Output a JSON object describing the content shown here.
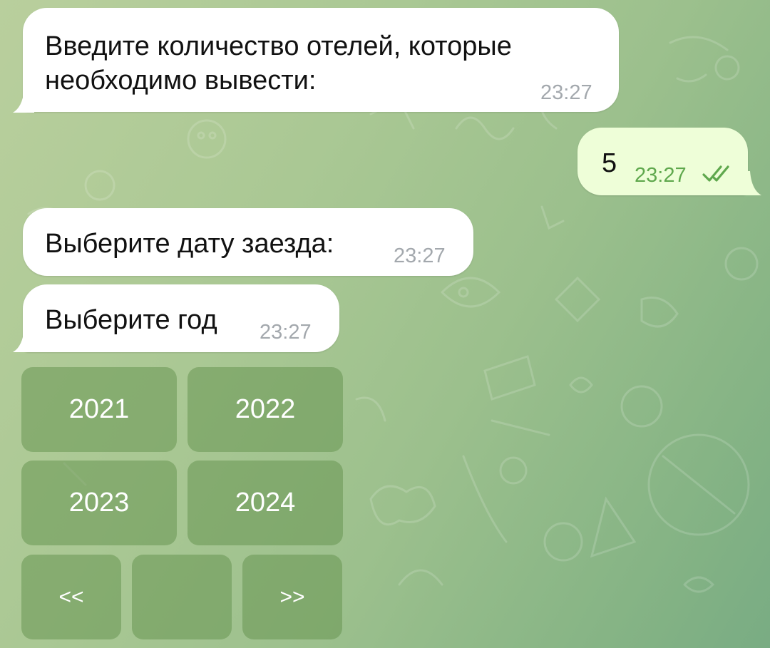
{
  "chat": {
    "messages": [
      {
        "direction": "incoming",
        "text": "Введите количество отелей, которые\nнеобходимо вывести:",
        "time": "23:27"
      },
      {
        "direction": "outgoing",
        "text": "5",
        "time": "23:27",
        "status": "read"
      },
      {
        "direction": "incoming",
        "text": "Выберите дату заезда:",
        "time": "23:27"
      },
      {
        "direction": "incoming",
        "text": "Выберите год",
        "time": "23:27"
      }
    ],
    "keyboard": {
      "rows": [
        [
          "2021",
          "2022"
        ],
        [
          "2023",
          "2024"
        ],
        [
          "<<",
          "",
          ">>"
        ]
      ]
    }
  },
  "colors": {
    "incoming_bubble": "#ffffff",
    "outgoing_bubble": "#eefed8",
    "time_incoming": "#a3a8ad",
    "time_outgoing": "#5fa84d",
    "keyboard_button": "#6a9656"
  },
  "icons": {
    "read_status": "double-check-icon"
  }
}
